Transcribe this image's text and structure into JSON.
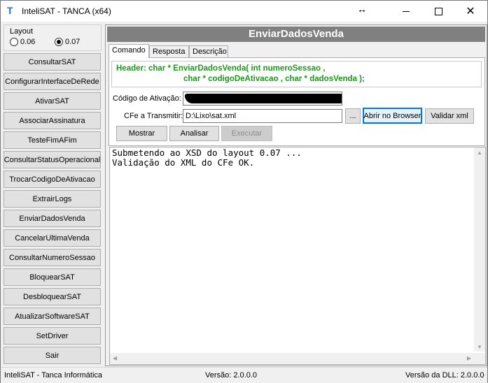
{
  "window": {
    "title": "InteliSAT - TANCA (x64)"
  },
  "layout": {
    "label": "Layout",
    "options": [
      "0.06",
      "0.07"
    ],
    "selected": "0.07"
  },
  "sidebar": {
    "buttons": [
      "ConsultarSAT",
      "ConfigurarInterfaceDeRede",
      "AtivarSAT",
      "AssociarAssinatura",
      "TesteFimAFim",
      "ConsultarStatusOperacional",
      "TrocarCodigoDeAtivacao",
      "ExtrairLogs",
      "EnviarDadosVenda",
      "CancelarUltimaVenda",
      "ConsultarNumeroSessao",
      "BloquearSAT",
      "DesbloquearSAT",
      "AtualizarSoftwareSAT",
      "SetDriver",
      "Sair"
    ]
  },
  "panel": {
    "title": "EnviarDadosVenda",
    "tabs": [
      "Comando",
      "Resposta",
      "Descrição"
    ],
    "active_tab": "Comando",
    "header_line1": "Header: char * EnviarDadosVenda( int numeroSessao ,",
    "header_line2": "char * codigoDeAtivacao , char * dadosVenda );",
    "codigo_label": "Código de Ativação:",
    "codigo_value": "",
    "cfe_label": "CFe a Transmitir:",
    "cfe_value": "D:\\Lixo\\sat.xml",
    "browse_label": "...",
    "abrir_label": "Abrir no Browser",
    "validar_label": "Validar xml",
    "mostrar_label": "Mostrar",
    "analisar_label": "Analisar",
    "executar_label": "Executar",
    "output_line1": "Submetendo ao XSD do layout 0.07 ...",
    "output_line2": "Validação do XML do CFe OK."
  },
  "status": {
    "app": "InteliSAT - Tanca Informática",
    "version": "Versão: 2.0.0.0",
    "dll_version": "Versão da DLL: 2.0.0.0"
  }
}
